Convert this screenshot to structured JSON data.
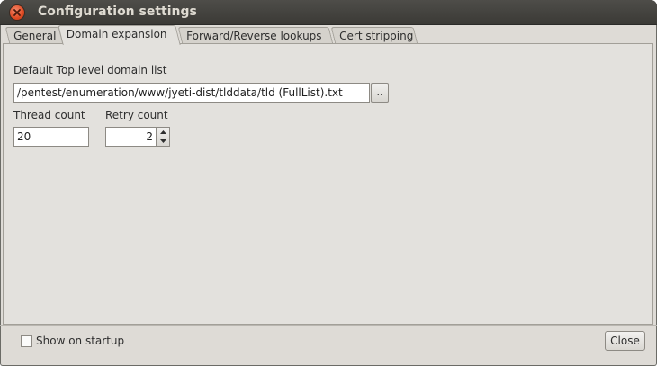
{
  "window": {
    "title": "Configuration settings"
  },
  "tabs": [
    {
      "label": "General",
      "active": false
    },
    {
      "label": "Domain expansion",
      "active": true
    },
    {
      "label": "Forward/Reverse lookups",
      "active": false
    },
    {
      "label": "Cert stripping",
      "active": false
    }
  ],
  "domain_expansion": {
    "tld_list_label": "Default Top level domain list",
    "tld_list_value": "/pentest/enumeration/www/jyeti-dist/tlddata/tld (FullList).txt",
    "browse_label": "..",
    "thread_count_label": "Thread count",
    "thread_count_value": "20",
    "retry_count_label": "Retry count",
    "retry_count_value": "2"
  },
  "footer": {
    "show_on_startup_label": "Show on startup",
    "show_on_startup_checked": false,
    "close_label": "Close"
  },
  "colors": {
    "titlebar": "#3b3a36",
    "close_icon": "#df4a22",
    "panel_background": "#e3e1dd"
  }
}
